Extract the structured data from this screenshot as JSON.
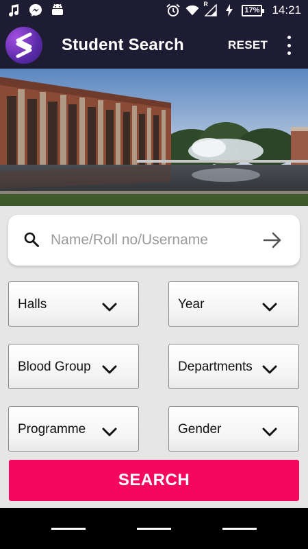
{
  "status_bar": {
    "icons": [
      "music-note-icon",
      "messenger-icon",
      "android-icon"
    ],
    "right_icons": [
      "alarm-icon",
      "wifi-icon",
      "signal-icon",
      "charging-icon"
    ],
    "roaming_label": "R",
    "battery_percent": "17%",
    "time": "14:21"
  },
  "app_bar": {
    "logo_icon": "app-logo-icon",
    "title": "Student Search",
    "reset_label": "RESET",
    "more_icon": "more-vert-icon"
  },
  "banner": {
    "image": "campus-building-fountain-photo"
  },
  "search": {
    "placeholder": "Name/Roll no/Username",
    "value": "",
    "search_icon": "search-icon",
    "submit_icon": "arrow-right-icon"
  },
  "filters": {
    "halls": "Halls",
    "year": "Year",
    "blood_group": "Blood Group",
    "departments": "Departments",
    "programme": "Programme",
    "gender": "Gender"
  },
  "search_button": {
    "label": "SEARCH"
  },
  "nav_bar": {
    "buttons": [
      "back-button",
      "home-button",
      "recents-button"
    ]
  },
  "colors": {
    "app_bar": "#1e1c33",
    "accent": "#f5075e",
    "logo": "#7b3bd0",
    "background": "#e6e6e6"
  }
}
